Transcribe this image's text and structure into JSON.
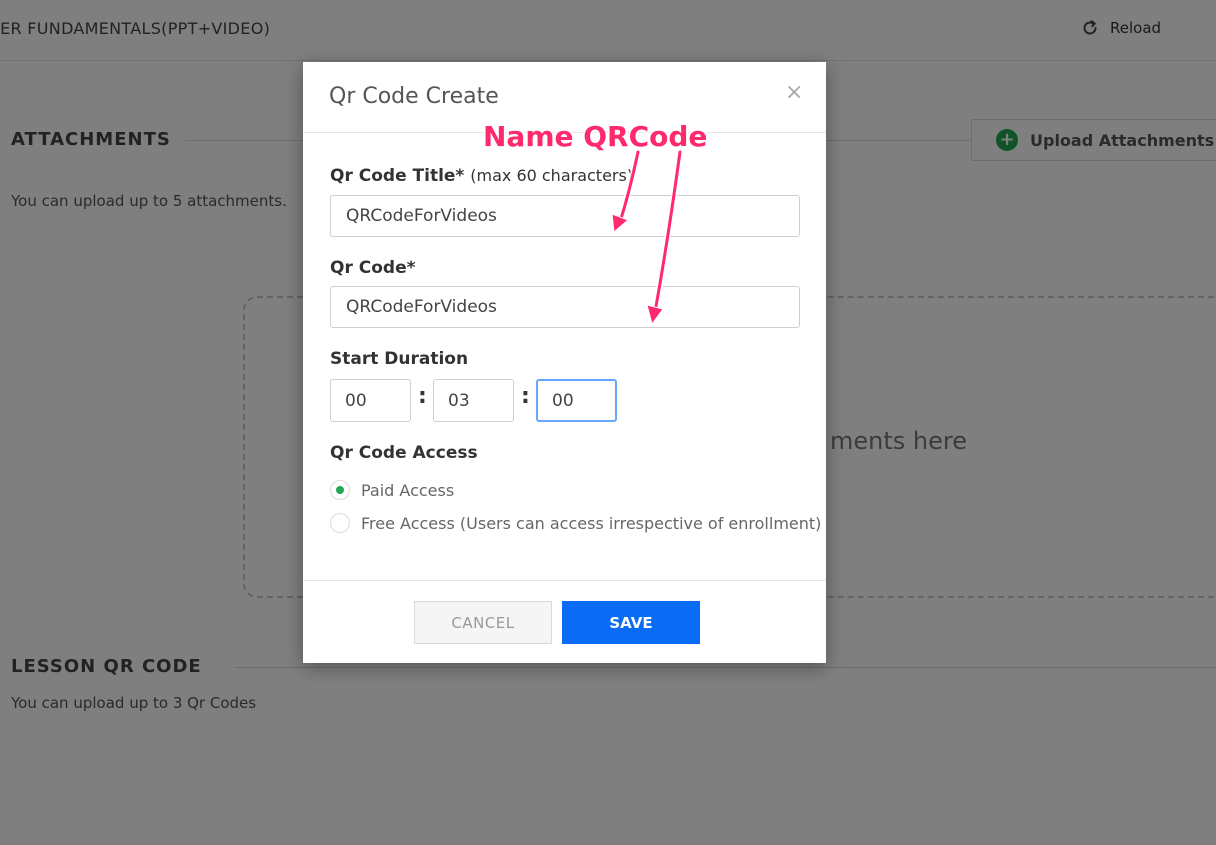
{
  "background": {
    "course_title": "TER FUNDAMENTALS(PPT+VIDEO)",
    "reload_label": "Reload",
    "attachments": {
      "heading": "ATTACHMENTS",
      "description": "You can upload up to 5 attachments.",
      "upload_button_label": "Upload Attachments",
      "dropzone_text": "ments here"
    },
    "lesson_qr": {
      "heading": "LESSON QR CODE",
      "description": "You can upload up to 3 Qr Codes"
    }
  },
  "modal": {
    "title": "Qr Code Create",
    "close_symbol": "×",
    "qr_title": {
      "label": "Qr Code Title*",
      "hint": "(max 60 characters)",
      "value": "QRCodeForVideos"
    },
    "qr_code": {
      "label": "Qr Code*",
      "value": "QRCodeForVideos"
    },
    "start_duration": {
      "label": "Start Duration",
      "hours": "00",
      "minutes": "03",
      "seconds": "00",
      "separator": ":"
    },
    "access": {
      "label": "Qr Code Access",
      "options": [
        {
          "label": "Paid Access",
          "checked": true
        },
        {
          "label": "Free Access (Users can access irrespective of enrollment)",
          "checked": false
        }
      ]
    },
    "cancel_label": "CANCEL",
    "save_label": "SAVE"
  },
  "annotation": {
    "text": "Name QRCode",
    "color": "#ff2a6d"
  },
  "colors": {
    "primary": "#0a6cf5",
    "success": "#22a653",
    "overlay": "rgba(0,0,0,0.5)"
  }
}
